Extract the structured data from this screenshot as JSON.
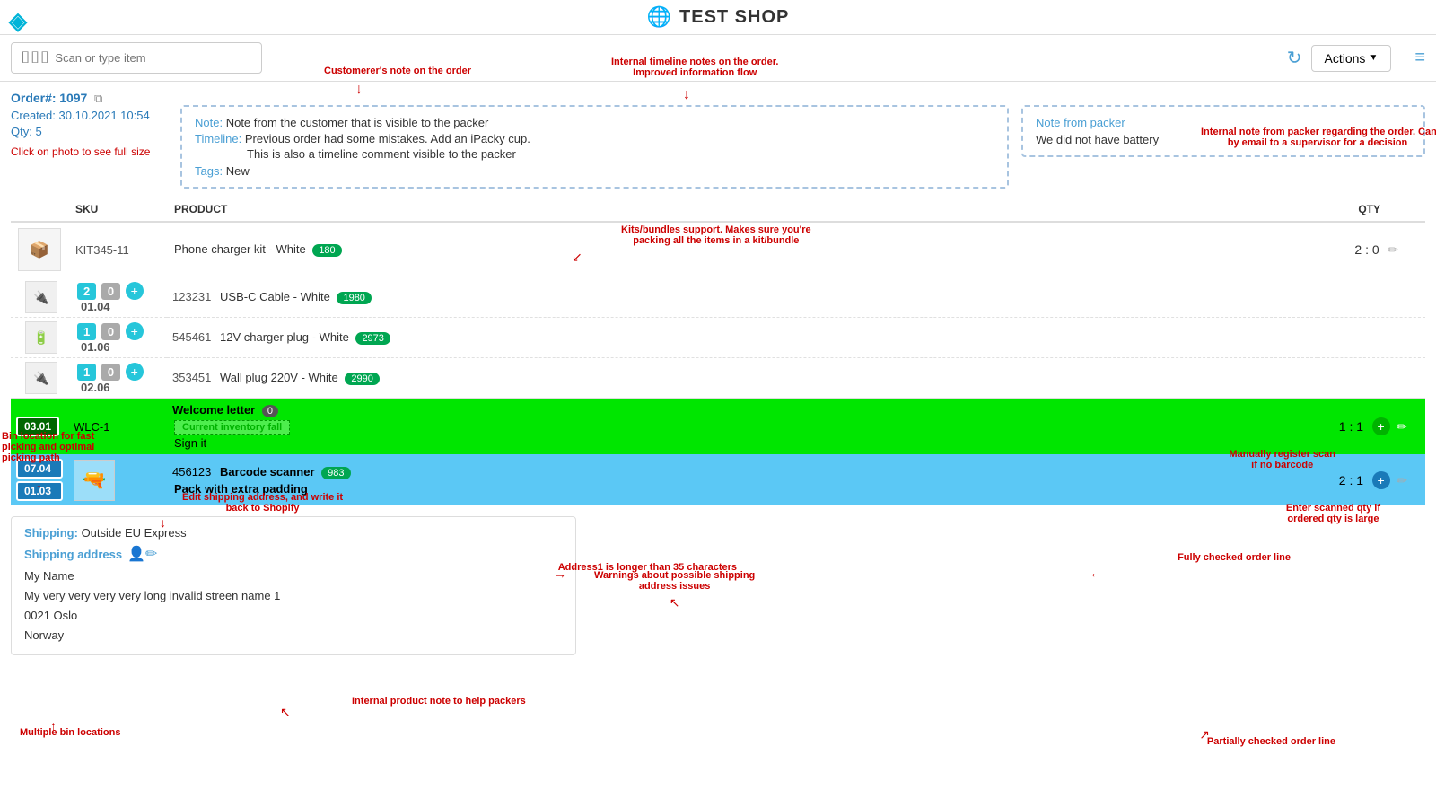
{
  "header": {
    "title": "TEST SHOP",
    "logo_symbol": "◈"
  },
  "toolbar": {
    "scan_placeholder": "Scan or type item",
    "actions_label": "Actions",
    "actions_arrow": "▼"
  },
  "order": {
    "number_label": "Order#:",
    "number": "1097",
    "created_label": "Created:",
    "created": "30.10.2021 10:54",
    "qty_label": "Qty:",
    "qty": "5",
    "photo_hint": "Click on photo to see full size"
  },
  "customer_note": {
    "label": "Note:",
    "text": "Note from the customer that is visible to the packer",
    "timeline_label": "Timeline:",
    "timeline": "Previous order had some mistakes. Add an iPacky cup.",
    "timeline2": "This is also a timeline comment visible to the packer",
    "tags_label": "Tags:",
    "tags": "New"
  },
  "packer_note": {
    "label": "Note from packer",
    "text": "We did not have battery"
  },
  "table": {
    "col_sku": "SKU",
    "col_product": "PRODUCT",
    "col_qty": "QTY"
  },
  "products": [
    {
      "type": "kit",
      "sku": "KIT345-11",
      "name": "Phone charger kit - White",
      "badge": "180",
      "qty": "2 : 0",
      "sub_items": [
        {
          "bin": "01.04",
          "sku": "123231",
          "name": "USB-C Cable - White",
          "badge": "1980",
          "qty_packed": "2",
          "qty_zero": "0"
        },
        {
          "bin": "01.06",
          "sku": "545461",
          "name": "12V charger plug - White",
          "badge": "2973",
          "qty_packed": "1",
          "qty_zero": "0"
        },
        {
          "bin": "02.06",
          "sku": "353451",
          "name": "Wall plug 220V - White",
          "badge": "2990",
          "qty_packed": "1",
          "qty_zero": "0"
        }
      ]
    },
    {
      "type": "checked",
      "bin": "03.01",
      "sku": "WLC-1",
      "name": "Welcome letter",
      "badge": "0",
      "badge_type": "circle",
      "qty": "1 : 1",
      "sub_note": "Sign it",
      "inventory_label": "Current inventory fall"
    },
    {
      "type": "partial",
      "bins": [
        "07.04",
        "01.03"
      ],
      "sku": "456123",
      "name": "Barcode scanner",
      "badge": "983",
      "qty": "2 : 1",
      "note": "Pack with extra padding"
    }
  ],
  "shipping": {
    "label": "Shipping:",
    "method": "Outside EU Express",
    "addr_label": "Shipping address",
    "name": "My Name",
    "street": "My very very very very long invalid streen name 1",
    "postal": "0021  Oslo",
    "country": "Norway"
  },
  "annotations": {
    "customer_note_ann": "Customerer's note on the order",
    "timeline_ann": "Internal timeline notes on the order. Improved information flow",
    "packer_note_ann": "Internal note from packer regarding the order. Can be sent by email to a supervisor for a decision",
    "kit_ann": "Kits/bundles support. Makes sure you're packing all the items in a kit/bundle",
    "bin_ann": "Bin location for fast picking and optimal picking path",
    "manual_scan_ann": "Manually register scan if no barcode",
    "enter_qty_ann": "Enter scanned qty if ordered qty is large",
    "fully_checked_ann": "Fully checked order line",
    "inventory_fall_ann": "Current inventory fall",
    "internal_product_ann": "Internal product note to help packers",
    "multiple_bin_ann": "Multiple bin locations",
    "partial_ann": "Partially checked order line",
    "address1_ann": "Address1 is longer than 35 characters",
    "shipping_warning_ann": "Warnings about possible shipping address issues",
    "edit_shipping_ann": "Edit shipping address, and write it back to Shopify"
  }
}
